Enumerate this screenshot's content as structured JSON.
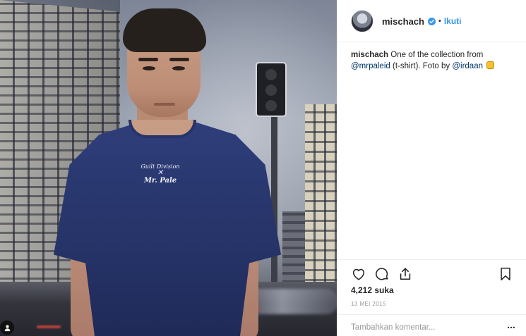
{
  "post": {
    "username": "mischach",
    "verified": true,
    "separator": "•",
    "follow_label": "Ikuti",
    "caption": {
      "user": "mischach",
      "text_1": "One of the collection from",
      "mention_1": "@mrpaleid",
      "text_2": "(t-shirt). Foto by",
      "mention_2": "@irdaan",
      "emoji": "fist-emoji"
    },
    "shirt_print": {
      "top": "Guilt Division",
      "middle": "✕",
      "bottom": "Mr. Pale"
    },
    "likes": "4,212 suka",
    "date": "13 MEI 2015",
    "comment_placeholder": "Tambahkan komentar...",
    "more_label": "...",
    "icons": {
      "like": "heart-icon",
      "comment": "comment-bubble-icon",
      "share": "share-icon",
      "save": "bookmark-icon",
      "tag": "user-tag-icon",
      "verified": "verified-badge-icon"
    },
    "colors": {
      "link": "#3897f0",
      "mention": "#003569",
      "text": "#262626",
      "muted": "#999999",
      "divider": "#efefef"
    }
  }
}
